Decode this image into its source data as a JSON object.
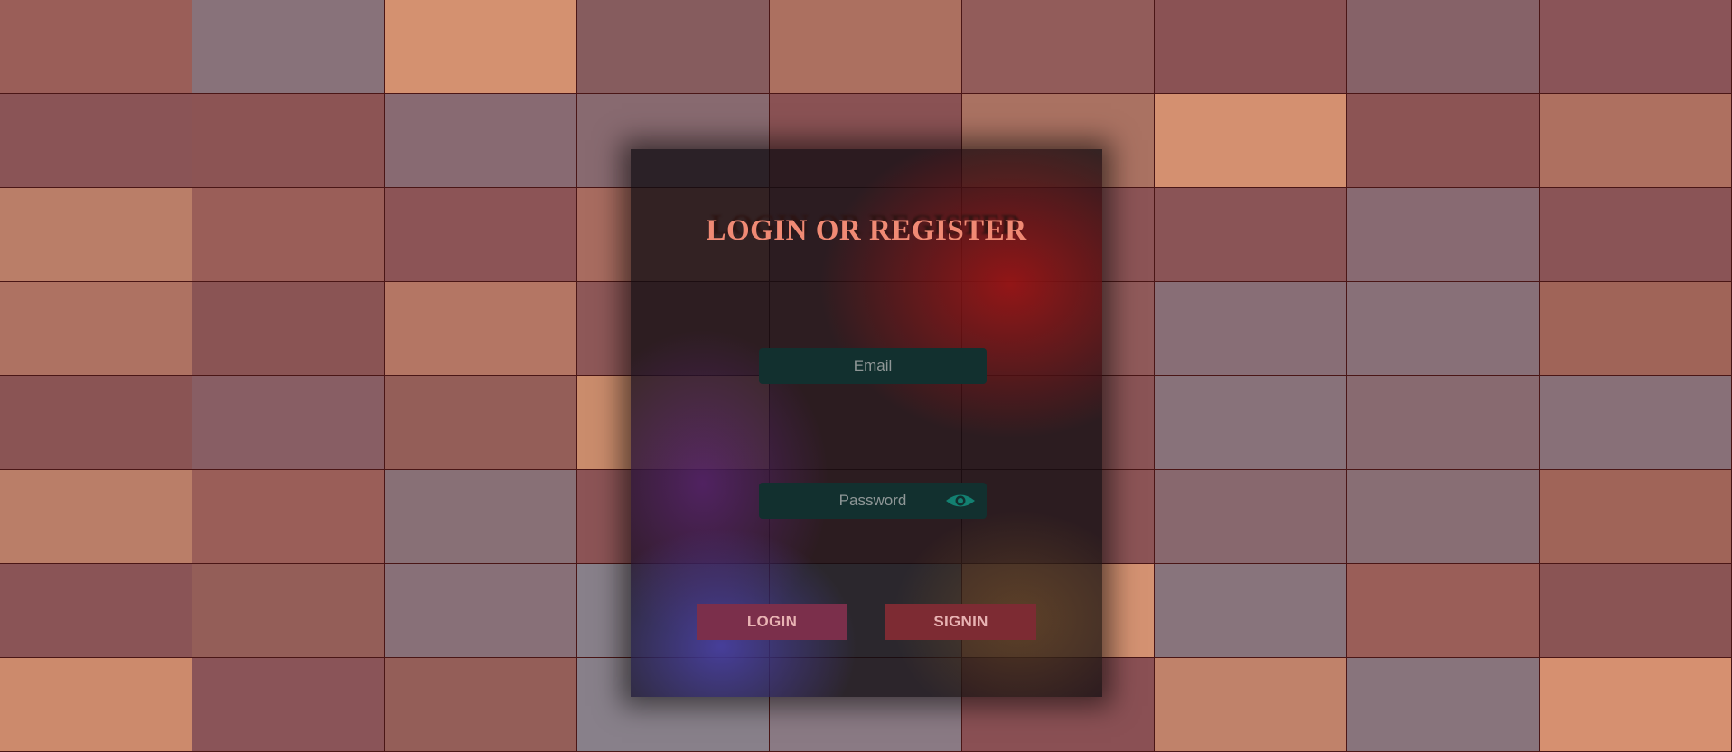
{
  "form": {
    "title": "LOGIN OR REGISTER",
    "email_placeholder": "Email",
    "password_placeholder": "Password",
    "login_label": "LOGIN",
    "signin_label": "SIGNIN",
    "password_toggle_icon": "eye-icon"
  },
  "colors": {
    "title": "#f08a74",
    "input_background": "#12302f",
    "eye_icon": "#138071",
    "login_button": "#7b2f4b",
    "signin_button": "#7d2b33",
    "button_text": "#e8b3b3"
  },
  "background": {
    "columns": 9,
    "rows": 8,
    "tile_colors": [
      "#9a5e58",
      "#88727a",
      "#d49170",
      "#865c5e",
      "#ac7060",
      "#925c5a",
      "#8a5254",
      "#866268",
      "#8a5458",
      "#8a5456",
      "#8c5454",
      "#886a72",
      "#886a70",
      "#8a5254",
      "#aa7262",
      "#d49070",
      "#8c5454",
      "#ae7060",
      "#ba7e68",
      "#9a5e58",
      "#8c5456",
      "#a86c60",
      "#8a5658",
      "#8c5456",
      "#8a5456",
      "#886a72",
      "#8a5456",
      "#ae7262",
      "#8a5454",
      "#b47664",
      "#8e5858",
      "#905a5a",
      "#905a5a",
      "#886e76",
      "#887078",
      "#a06458",
      "#8a5454",
      "#885e64",
      "#945e58",
      "#ca8c6c",
      "#8c5456",
      "#8a5456",
      "#88727a",
      "#886a70",
      "#887078",
      "#ba7e68",
      "#9a5e58",
      "#887076",
      "#8c5456",
      "#8c5456",
      "#8c5456",
      "#88686e",
      "#886e74",
      "#a06458",
      "#8a5456",
      "#945e58",
      "#887078",
      "#88808a",
      "#88808a",
      "#d49272",
      "#88747c",
      "#9a5e58",
      "#8a5454",
      "#cc8a6c",
      "#8a5458",
      "#945e58",
      "#88808a",
      "#8a7a84",
      "#8a5054",
      "#c0826a",
      "#88747c",
      "#d69070"
    ]
  }
}
